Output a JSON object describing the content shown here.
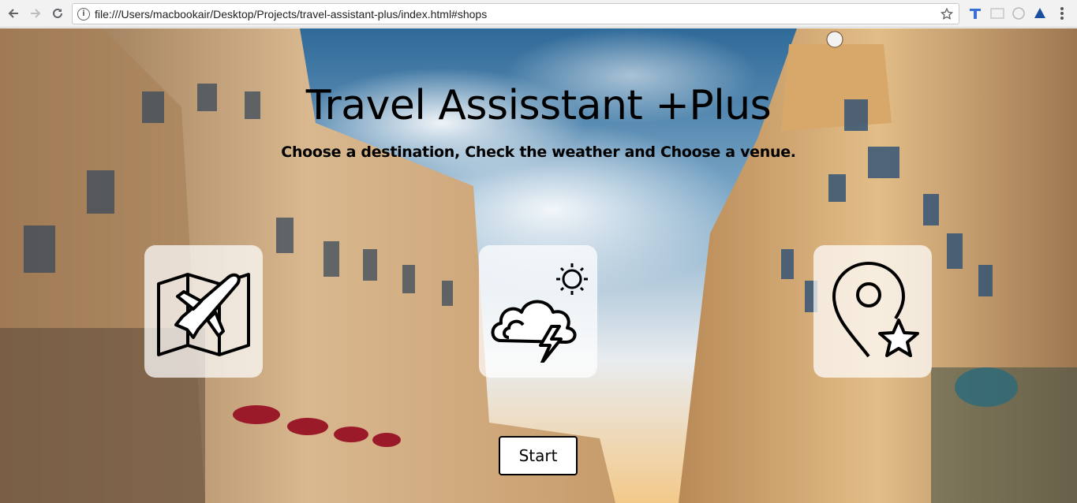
{
  "browser": {
    "url": "file:///Users/macbookair/Desktop/Projects/travel-assistant-plus/index.html#shops",
    "info_icon": "info-icon",
    "extensions": [
      "t-extension-icon",
      "cast-icon",
      "circle-extension-icon",
      "drive-extension-icon",
      "menu-dots-icon"
    ]
  },
  "hero": {
    "title": "Travel Assisstant +Plus",
    "subtitle": "Choose a destination, Check the weather and Choose a venue."
  },
  "cards": [
    {
      "name": "destination-card",
      "icon": "map-plane-icon"
    },
    {
      "name": "weather-card",
      "icon": "weather-storm-icon"
    },
    {
      "name": "venue-card",
      "icon": "location-star-icon"
    }
  ],
  "start_button": {
    "label": "Start"
  },
  "colors": {
    "card_bg": "#ffffffb8",
    "text": "#000000"
  }
}
